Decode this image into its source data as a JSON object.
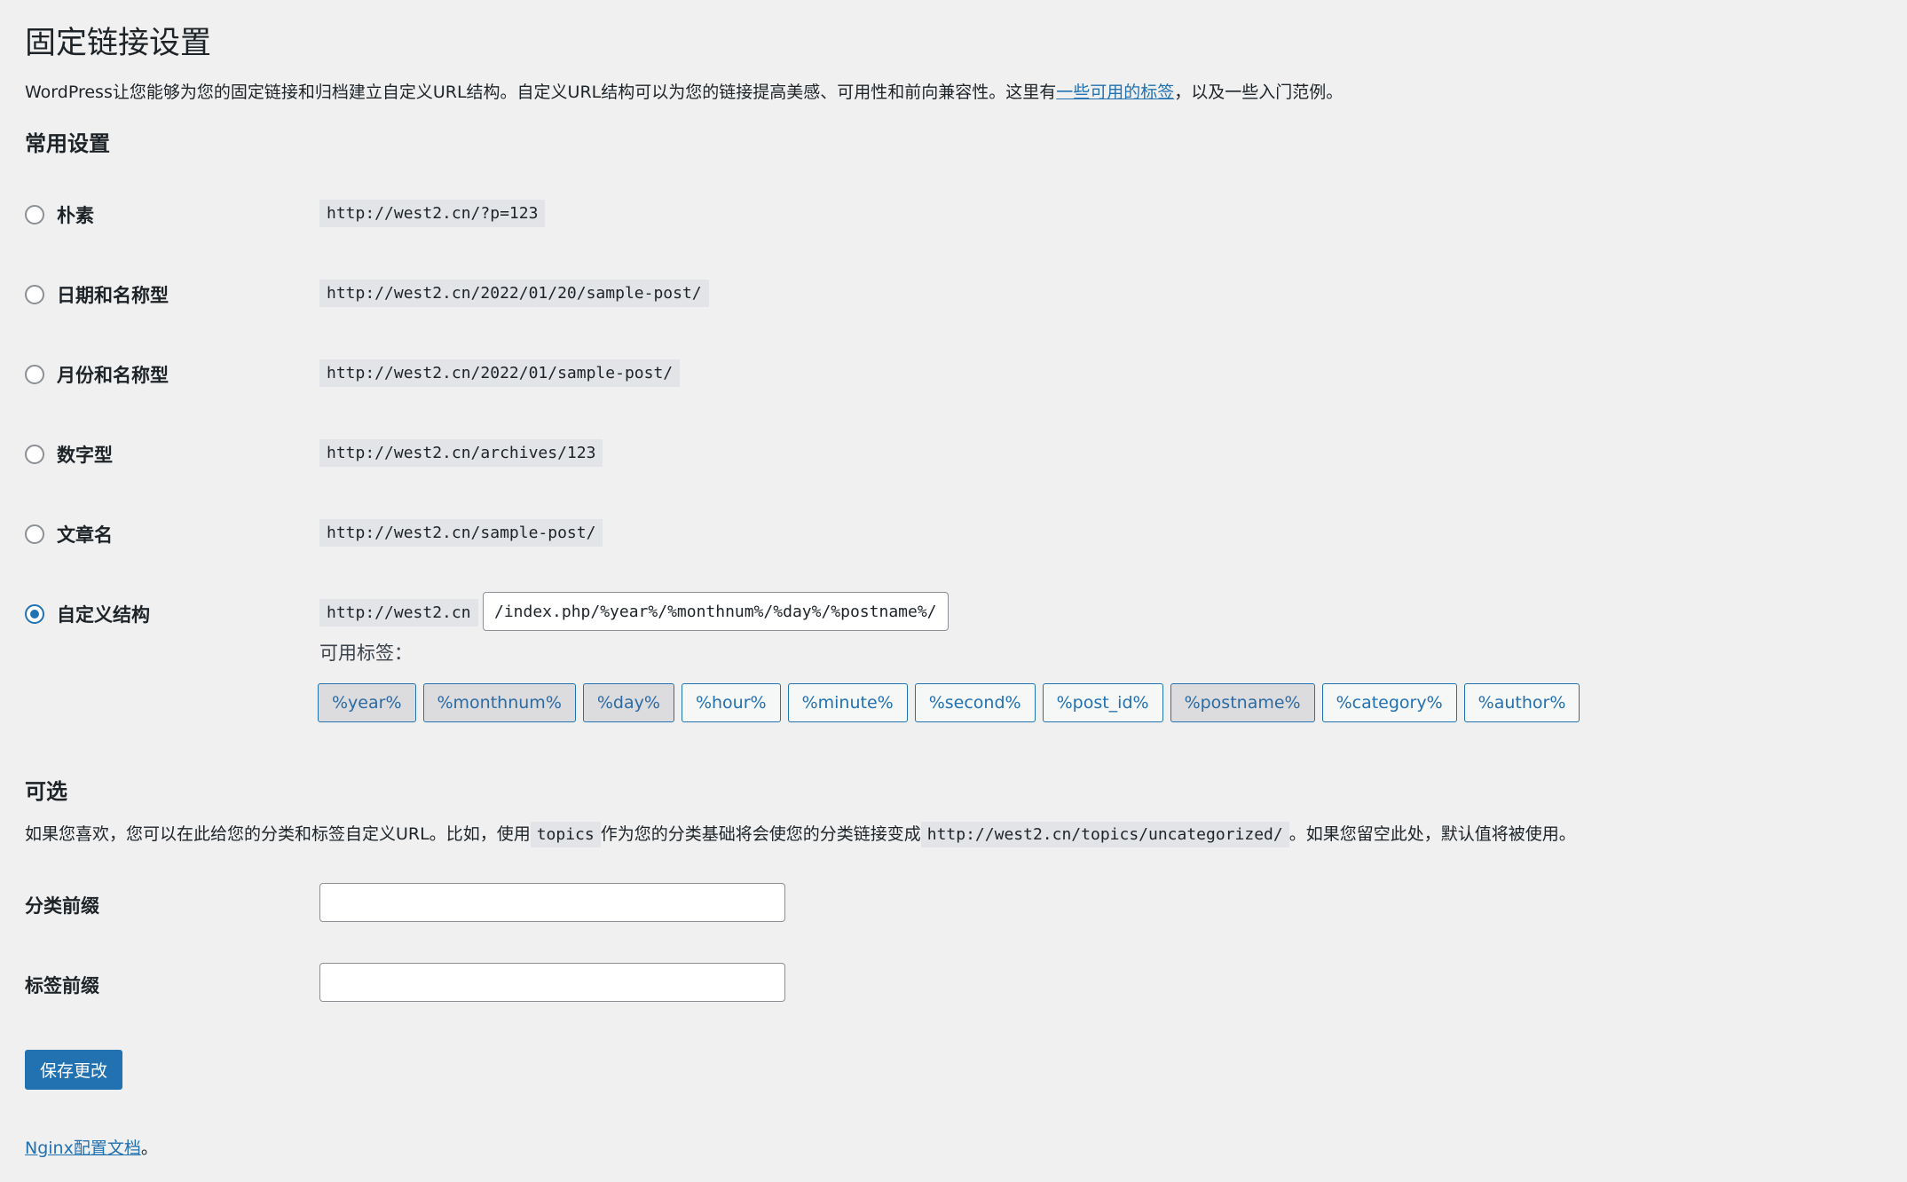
{
  "page": {
    "title": "固定链接设置",
    "intro_before": "WordPress让您能够为您的固定链接和归档建立自定义URL结构。自定义URL结构可以为您的链接提高美感、可用性和前向兼容性。这里有",
    "intro_link": "一些可用的标签",
    "intro_after": "，以及一些入门范例。"
  },
  "common": {
    "heading": "常用设置",
    "options": [
      {
        "label": "朴素",
        "example": "http://west2.cn/?p=123",
        "checked": false
      },
      {
        "label": "日期和名称型",
        "example": "http://west2.cn/2022/01/20/sample-post/",
        "checked": false
      },
      {
        "label": "月份和名称型",
        "example": "http://west2.cn/2022/01/sample-post/",
        "checked": false
      },
      {
        "label": "数字型",
        "example": "http://west2.cn/archives/123",
        "checked": false
      },
      {
        "label": "文章名",
        "example": "http://west2.cn/sample-post/",
        "checked": false
      },
      {
        "label": "自定义结构",
        "example": "http://west2.cn",
        "checked": true
      }
    ],
    "custom_value": "/index.php/%year%/%monthnum%/%day%/%postname%/",
    "tags_label": "可用标签：",
    "tags": [
      {
        "label": "%year%",
        "active": true
      },
      {
        "label": "%monthnum%",
        "active": true
      },
      {
        "label": "%day%",
        "active": true
      },
      {
        "label": "%hour%",
        "active": false
      },
      {
        "label": "%minute%",
        "active": false
      },
      {
        "label": "%second%",
        "active": false
      },
      {
        "label": "%post_id%",
        "active": false
      },
      {
        "label": "%postname%",
        "active": true
      },
      {
        "label": "%category%",
        "active": false
      },
      {
        "label": "%author%",
        "active": false
      }
    ]
  },
  "optional": {
    "heading": "可选",
    "desc_1": "如果您喜欢，您可以在此给您的分类和标签自定义URL。比如，使用",
    "desc_code_1": "topics",
    "desc_2": "作为您的分类基础将会使您的分类链接变成",
    "desc_code_2": "http://west2.cn/topics/uncategorized/",
    "desc_3": "。如果您留空此处，默认值将被使用。",
    "category_label": "分类前缀",
    "tag_label": "标签前缀"
  },
  "actions": {
    "save_label": "保存更改"
  },
  "footer": {
    "link": "Nginx配置文档",
    "after": "。"
  }
}
